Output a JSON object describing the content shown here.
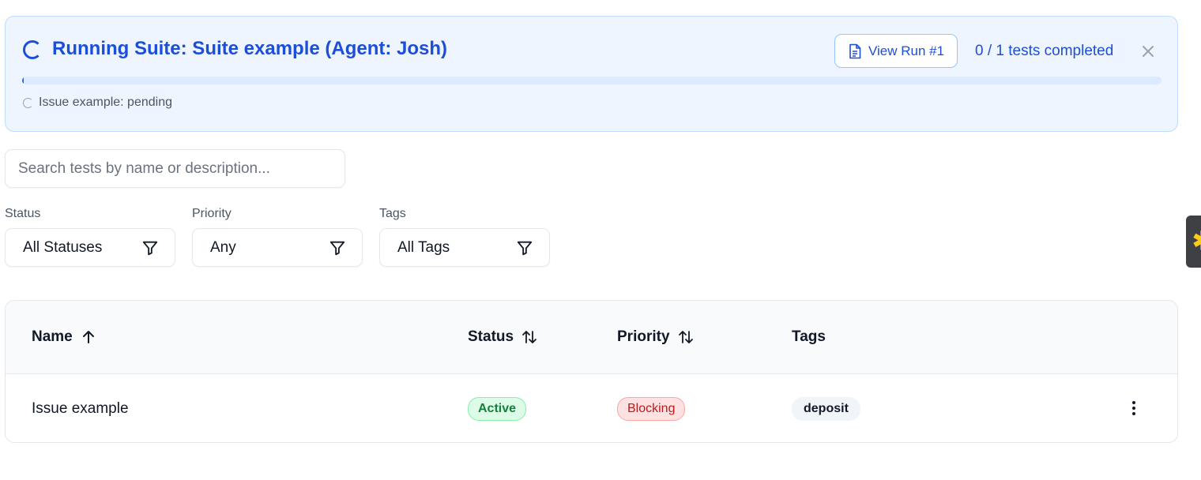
{
  "banner": {
    "title": "Running Suite: Suite example (Agent: Josh)",
    "view_run_label": "View Run #1",
    "progress_text": "0 / 1 tests completed",
    "progress_fraction": 0,
    "issue_status": "Issue example: pending"
  },
  "search": {
    "placeholder": "Search tests by name or description...",
    "value": ""
  },
  "filters": [
    {
      "label": "Status",
      "value": "All Statuses"
    },
    {
      "label": "Priority",
      "value": "Any"
    },
    {
      "label": "Tags",
      "value": "All Tags"
    }
  ],
  "table": {
    "columns": [
      "Name",
      "Status",
      "Priority",
      "Tags"
    ],
    "rows": [
      {
        "name": "Issue example",
        "status": "Active",
        "priority": "Blocking",
        "tag": "deposit"
      }
    ]
  },
  "colors": {
    "accent": "#1d4ed8",
    "banner_bg": "#eef5ff",
    "active_badge": "#dcfce7",
    "blocking_badge": "#fee2e2"
  },
  "icons": [
    "spinner-icon",
    "document-icon",
    "close-icon",
    "filter-icon",
    "sort-asc-icon",
    "sort-icon",
    "more-vertical-icon"
  ]
}
